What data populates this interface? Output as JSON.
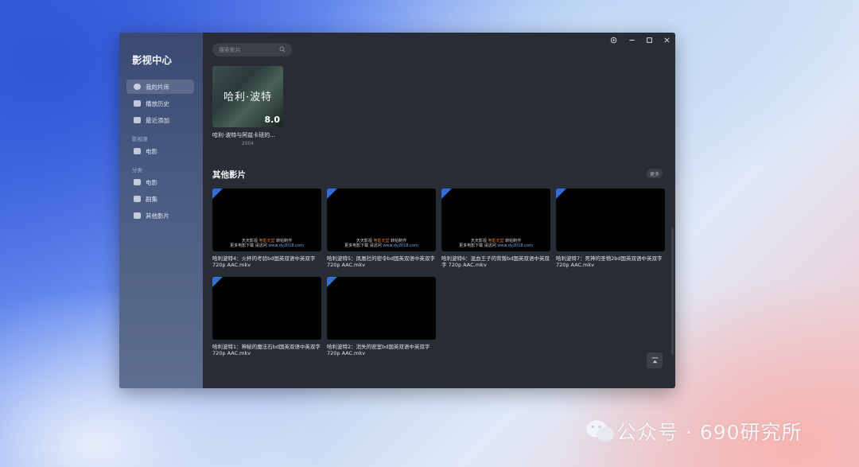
{
  "app": {
    "title": "影视中心"
  },
  "sidebar": {
    "items": [
      {
        "label": "我的片库",
        "icon": "film-reel-icon",
        "active": true
      },
      {
        "label": "播放历史",
        "icon": "video-icon"
      },
      {
        "label": "最近添加",
        "icon": "recent-icon"
      }
    ],
    "sections": [
      {
        "label": "影视源",
        "items": [
          {
            "label": "电影",
            "icon": "folder-icon"
          }
        ]
      },
      {
        "label": "分类",
        "items": [
          {
            "label": "电影",
            "icon": "car-icon"
          },
          {
            "label": "剧集",
            "icon": "tv-icon"
          },
          {
            "label": "其他影片",
            "icon": "list-icon"
          }
        ]
      }
    ]
  },
  "search": {
    "placeholder": "搜索影片",
    "icon": "search-icon"
  },
  "window_controls": [
    "settings-icon",
    "minimize-icon",
    "maximize-icon",
    "close-icon"
  ],
  "featured": {
    "poster_text": "哈利·波特",
    "rating": "8.0",
    "title": "哈利·波特与阿兹卡班的...",
    "year": "2004"
  },
  "other": {
    "title": "其他影片",
    "more_label": "更多",
    "watermark": {
      "line1_a": "天天影视",
      "line1_red": "电影天堂",
      "line1_c": "转帖制作",
      "line2_a": "更多电影下载 请访问",
      "line2_url": "www.dy2018.com"
    },
    "items": [
      {
        "title": "哈利波特4：火杯的考验bd国英双语中英双字720p AAC.mkv",
        "watermark": true
      },
      {
        "title": "哈利波特5：凤凰社的密令bd国英双语中英双字720p AAC.mkv",
        "watermark": true
      },
      {
        "title": "哈利波特6：混血王子的背叛bd国英双语中英双字 720p AAC.mkv",
        "watermark": true
      },
      {
        "title": "哈利波特7：死神的圣物2bd国英双语中英双字720p AAC.mkv",
        "watermark": false
      },
      {
        "title": "哈利波特1：神秘的魔法石bd国英双语中英双字720p AAC.mkv",
        "watermark": false
      },
      {
        "title": "哈利波特2：消失的密室bd国英双语中英双字720p AAC.mkv",
        "watermark": false
      }
    ]
  },
  "desktop_watermark": {
    "text": "公众号 · 690研究所",
    "icon": "wechat-icon"
  }
}
